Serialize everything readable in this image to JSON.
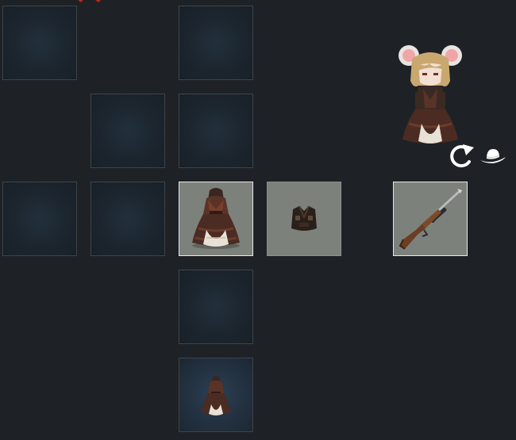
{
  "screen": "equipment-grid",
  "character": {
    "name": "",
    "portrait_icon": "mouse-eared-girl-portrait-icon"
  },
  "controls": {
    "rotate_icon": "rotate-arrow-icon",
    "hat_toggle_icon": "hat-icon"
  },
  "slots": [
    {
      "id": "r0c0",
      "state": "empty"
    },
    {
      "id": "r0c2",
      "state": "empty"
    },
    {
      "id": "r1c1",
      "state": "empty"
    },
    {
      "id": "r1c2",
      "state": "empty"
    },
    {
      "id": "r2c0",
      "state": "empty"
    },
    {
      "id": "r2c1",
      "state": "empty"
    },
    {
      "id": "r2c2",
      "state": "equipped",
      "icon": "dress-icon",
      "selected": true
    },
    {
      "id": "r2c3",
      "state": "equipped",
      "icon": "vest-icon",
      "selected": false
    },
    {
      "id": "r2c5",
      "state": "equipped",
      "icon": "rifle-icon",
      "selected": true
    },
    {
      "id": "r3c2",
      "state": "empty"
    },
    {
      "id": "r4c2",
      "state": "item",
      "icon": "dress-icon"
    }
  ],
  "colors": {
    "background": "#1e2226",
    "empty_slot": "#1c252e",
    "equipped_slot": "#7d817c",
    "selected_border": "#e6e8e6"
  }
}
